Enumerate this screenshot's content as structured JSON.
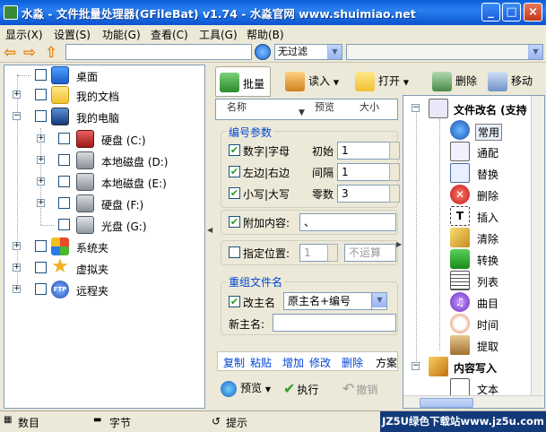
{
  "window": {
    "title": "水淼 - 文件批量处理器(GFileBat) v1.74 - 水淼官网 www.shuimiao.net",
    "buttons": [
      "_",
      "□",
      "×"
    ]
  },
  "menu": [
    "显示(X)",
    "设置(S)",
    "功能(G)",
    "查看(C)",
    "工具(G)",
    "帮助(B)"
  ],
  "address": {
    "path_value": "",
    "filter_selected": "无过滤",
    "second_combo": ""
  },
  "tree": [
    {
      "label": "桌面",
      "icon": "desktop-icon",
      "indent": 0,
      "expander": false
    },
    {
      "label": "我的文档",
      "icon": "folder-icon",
      "indent": 0,
      "expander": true
    },
    {
      "label": "我的电脑",
      "icon": "computer-icon",
      "indent": 0,
      "expander": true,
      "expanded": true
    },
    {
      "label": "硬盘 (C:)",
      "icon": "harddisk-icon",
      "indent": 1,
      "expander": true
    },
    {
      "label": "本地磁盘 (D:)",
      "icon": "harddisk-icon",
      "indent": 1,
      "expander": true
    },
    {
      "label": "本地磁盘 (E:)",
      "icon": "harddisk-icon",
      "indent": 1,
      "expander": true
    },
    {
      "label": "硬盘 (F:)",
      "icon": "harddisk-icon",
      "indent": 1,
      "expander": true
    },
    {
      "label": "光盘 (G:)",
      "icon": "cdrom-icon",
      "indent": 1,
      "expander": false
    },
    {
      "label": "系统夹",
      "icon": "windows-icon",
      "indent": 0,
      "expander": true
    },
    {
      "label": "虚拟夹",
      "icon": "star-icon",
      "indent": 0,
      "expander": true
    },
    {
      "label": "远程夹",
      "icon": "ftp-icon",
      "indent": 0,
      "expander": true
    }
  ],
  "toolbar": {
    "batch": "批量",
    "read": "读入",
    "open": "打开",
    "delete": "删除",
    "move": "移动"
  },
  "file_columns": [
    "名称",
    "预览",
    "大小"
  ],
  "numbering": {
    "group_title": "编号参数",
    "digit_alpha": "数字|字母",
    "left_right": "左边|右边",
    "lower_upper": "小写|大写",
    "start_label": "初始",
    "start_value": "1",
    "interval_label": "间隔",
    "interval_value": "1",
    "zeros_label": "零数",
    "zeros_value": "3"
  },
  "append": {
    "label": "附加内容:",
    "value": "、"
  },
  "position": {
    "label": "指定位置:",
    "value": "1",
    "op": "不运算"
  },
  "rename": {
    "group_title": "重组文件名",
    "change_main": "改主名",
    "pattern": "原主名+编号",
    "new_main_label": "新主名:",
    "new_main_value": ""
  },
  "actions": {
    "copy": "复制",
    "paste": "粘贴",
    "add": "增加",
    "modify": "修改",
    "remove": "删除",
    "scheme": "方案"
  },
  "bottom": {
    "preview": "预览",
    "execute": "执行",
    "undo": "撤销"
  },
  "function_tree": {
    "root1": "文件改名 (支持",
    "items": [
      "常用",
      "通配",
      "替换",
      "删除",
      "插入",
      "清除",
      "转换",
      "列表",
      "曲目",
      "时间",
      "提取"
    ],
    "root2": "内容写入",
    "sub2": [
      "文本"
    ]
  },
  "status": {
    "count_label": "数目",
    "bytes_label": "字节",
    "hint_label": "提示",
    "watermark": "JZ5U绿色下载站www.jz5u.com"
  },
  "colors": {
    "titlebar": "#0b53cf",
    "accent_text": "#0046d5",
    "check_mark": "#21a121"
  }
}
